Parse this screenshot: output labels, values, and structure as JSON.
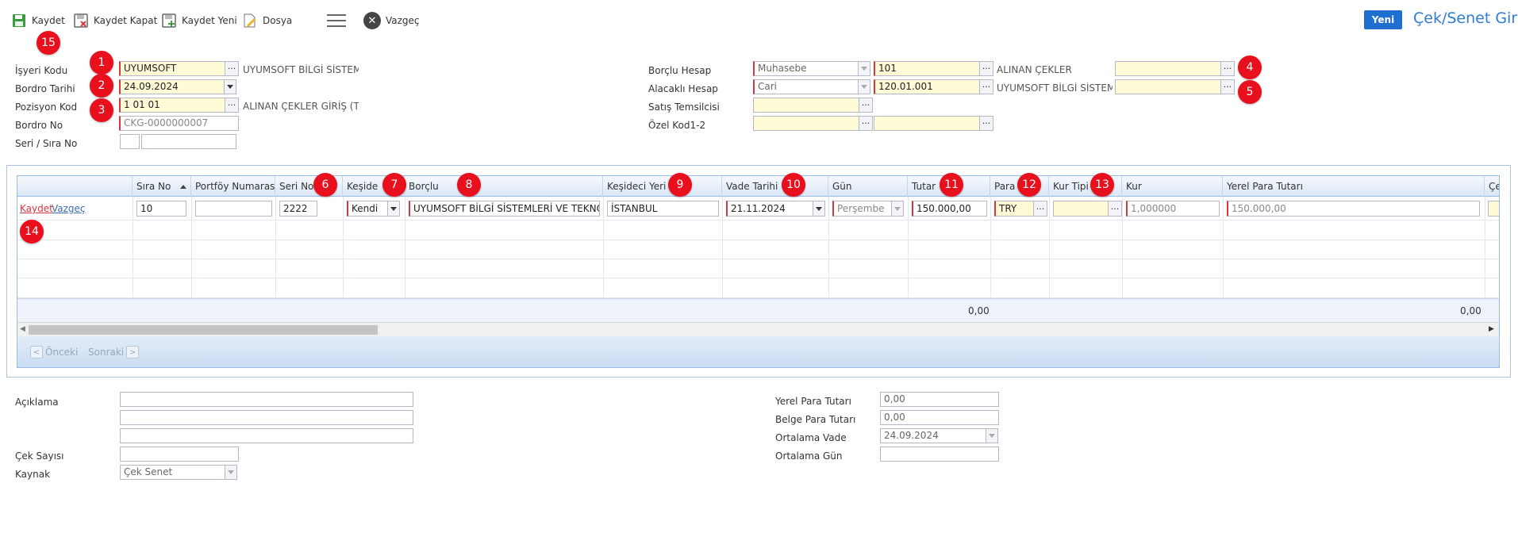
{
  "toolbar": {
    "save": "Kaydet",
    "save_close": "Kaydet Kapat",
    "save_new": "Kaydet Yeni",
    "file": "Dosya",
    "cancel": "Vazgeç",
    "new_button": "Yeni",
    "page_title": "Çek/Senet Giriş"
  },
  "badges": [
    "1",
    "2",
    "3",
    "4",
    "5",
    "6",
    "7",
    "8",
    "9",
    "10",
    "11",
    "12",
    "13",
    "14",
    "15"
  ],
  "form_left": {
    "isyeri_label": "İşyeri Kodu",
    "isyeri_value": "UYUMSOFT",
    "isyeri_desc": "UYUMSOFT BİLGİ SİSTEML",
    "bordro_tarihi_label": "Bordro Tarihi",
    "bordro_tarihi_value": "24.09.2024",
    "pozisyon_label": "Pozisyon Kod",
    "pozisyon_value": "1 01 01",
    "pozisyon_desc": "ALINAN ÇEKLER GİRİŞ (TL)",
    "bordro_no_label": "Bordro No",
    "bordro_no_value": "CKG-0000000007",
    "seri_sira_label": "Seri / Sıra No",
    "seri_value": "",
    "sira_value": ""
  },
  "form_right": {
    "borclu_label": "Borçlu Hesap",
    "borclu_type": "Muhasebe",
    "borclu_code": "101",
    "borclu_desc": "ALINAN ÇEKLER",
    "borclu_extra": "",
    "alacakli_label": "Alacaklı Hesap",
    "alacakli_type": "Cari",
    "alacakli_code": "120.01.001",
    "alacakli_desc": "UYUMSOFT BİLGİ SİSTEML",
    "alacakli_extra": "",
    "satis_label": "Satış Temsilcisi",
    "satis_value": "",
    "ozel_label": "Özel Kod1-2",
    "ozel1_value": "",
    "ozel2_value": ""
  },
  "grid": {
    "columns": [
      "Sıra No",
      "Portföy Numarası",
      "Seri No",
      "Keşide",
      "Borçlu",
      "Keşideci Yeri",
      "Vade Tarihi",
      "Gün",
      "Tutar",
      "Para",
      "Kur Tipi",
      "Kur",
      "Yerel Para Tutarı",
      "Çev"
    ],
    "row_actions": {
      "save": "Kaydet",
      "cancel": "Vazgeç"
    },
    "row": {
      "sira_no": "10",
      "portfoy": "",
      "seri_no": "2222",
      "keside": "Kendi",
      "borclu": "UYUMSOFT BİLGİ SİSTEMLERİ VE TEKNOLOJ",
      "kesideci_yeri": "İSTANBUL",
      "vade_tarihi": "21.11.2024",
      "gun": "Perşembe",
      "tutar": "150.000,00",
      "para": "TRY",
      "kur_tipi": "",
      "kur": "1,000000",
      "yerel_tutar": "150.000,00"
    },
    "summary_tutar": "0,00",
    "summary_yerel": "0,00",
    "pager_prev": "Önceki",
    "pager_next": "Sonraki"
  },
  "bottom_left": {
    "aciklama_label": "Açıklama",
    "aciklama1": "",
    "aciklama2": "",
    "aciklama3": "",
    "cek_sayisi_label": "Çek Sayısı",
    "cek_sayisi_value": "",
    "kaynak_label": "Kaynak",
    "kaynak_value": "Çek Senet"
  },
  "bottom_right": {
    "yerel_para_label": "Yerel Para Tutarı",
    "yerel_para_value": "0,00",
    "belge_para_label": "Belge Para Tutarı",
    "belge_para_value": "0,00",
    "ortalama_vade_label": "Ortalama Vade",
    "ortalama_vade_value": "24.09.2024",
    "ortalama_gun_label": "Ortalama Gün",
    "ortalama_gun_value": ""
  },
  "colors": {
    "accent": "#1f6fd1",
    "title": "#2e7bd6",
    "badge": "#e8101c",
    "required_bg": "#fffbd6",
    "link_red": "#d9363e",
    "link_blue": "#3a6fb0"
  }
}
